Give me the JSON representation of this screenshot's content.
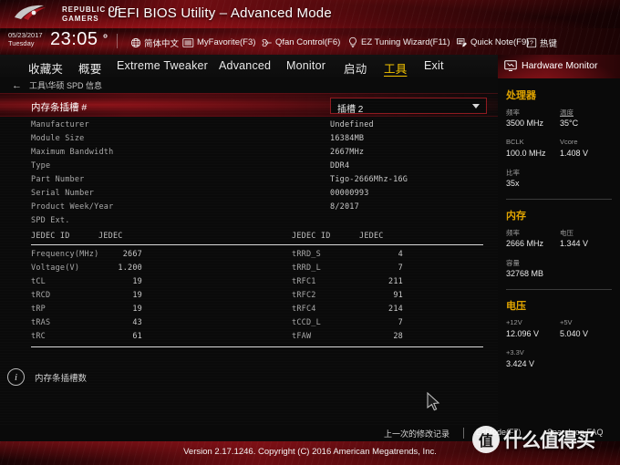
{
  "banner": {
    "brand_line1": "REPUBLIC OF",
    "brand_line2": "GAMERS",
    "title": "UEFI BIOS Utility – Advanced Mode",
    "logo_icon": "rog-eye-logo"
  },
  "toolbar": {
    "date": "05/23/2017",
    "weekday": "Tuesday",
    "time": "23:05",
    "gear_icon": "gear-icon",
    "items": [
      {
        "label": "简体中文",
        "icon": "globe-icon"
      },
      {
        "label": "MyFavorite(F3)",
        "icon": "bookmark-icon"
      },
      {
        "label": "Qfan Control(F6)",
        "icon": "fan-icon"
      },
      {
        "label": "EZ Tuning Wizard(F11)",
        "icon": "lightbulb-icon"
      },
      {
        "label": "Quick Note(F9)",
        "icon": "note-icon"
      },
      {
        "label": "热键",
        "icon": "question-key-icon"
      }
    ]
  },
  "nav": {
    "tabs": [
      {
        "label": "收藏夹",
        "active": false
      },
      {
        "label": "概要",
        "active": false
      },
      {
        "label": "Extreme Tweaker",
        "active": false
      },
      {
        "label": "Advanced",
        "active": false
      },
      {
        "label": "Monitor",
        "active": false
      },
      {
        "label": "启动",
        "active": false
      },
      {
        "label": "工具",
        "active": true
      },
      {
        "label": "Exit",
        "active": false
      }
    ]
  },
  "breadcrumb": {
    "back_arrow": "←",
    "path": "工具\\华硕 SPD 信息"
  },
  "main": {
    "selected_row_label": "内存条插槽 #",
    "dropdown": {
      "value": "插槽 2",
      "chevron_icon": "chevron-down-icon"
    },
    "specs": [
      {
        "key": "Manufacturer",
        "value": "Undefined"
      },
      {
        "key": "Module Size",
        "value": "16384MB"
      },
      {
        "key": "Maximum Bandwidth",
        "value": "2667MHz"
      },
      {
        "key": "Type",
        "value": "DDR4"
      },
      {
        "key": "Part Number",
        "value": "Tigo-2666Mhz-16G"
      },
      {
        "key": "Serial Number",
        "value": "00000993"
      },
      {
        "key": "Product Week/Year",
        "value": " 8/2017"
      },
      {
        "key": "SPD Ext.",
        "value": ""
      }
    ],
    "jedec_headers": {
      "id": "JEDEC ID",
      "profile": "JEDEC"
    },
    "jedec_left": [
      {
        "key": "Frequency(MHz)",
        "value": "2667"
      },
      {
        "key": "Voltage(V)",
        "value": "1.200"
      },
      {
        "key": "tCL",
        "value": "19"
      },
      {
        "key": "tRCD",
        "value": "19"
      },
      {
        "key": "tRP",
        "value": "19"
      },
      {
        "key": "tRAS",
        "value": "43"
      },
      {
        "key": "tRC",
        "value": "61"
      }
    ],
    "jedec_right": [
      {
        "key": "tRRD_S",
        "value": "4"
      },
      {
        "key": "tRRD_L",
        "value": "7"
      },
      {
        "key": "tRFC1",
        "value": "211"
      },
      {
        "key": "tRFC2",
        "value": "91"
      },
      {
        "key": "tRFC4",
        "value": "214"
      },
      {
        "key": "tCCD_L",
        "value": "7"
      },
      {
        "key": "tFAW",
        "value": "28"
      }
    ],
    "info": {
      "icon": "info-icon",
      "text": "内存条插槽数"
    }
  },
  "hardware_monitor": {
    "title": "Hardware Monitor",
    "title_icon": "monitor-icon",
    "sections": [
      {
        "name": "处理器",
        "rows": [
          {
            "label_left": "频率",
            "value_left": "3500 MHz",
            "label_right": "温度",
            "value_right": "35°C",
            "underline_right": true
          },
          {
            "label_left": "BCLK",
            "value_left": "100.0 MHz",
            "label_right": "Vcore",
            "value_right": "1.408 V",
            "underline_right": false
          },
          {
            "label_left": "比率",
            "value_left": "35x",
            "label_right": "",
            "value_right": "",
            "underline_right": false
          }
        ]
      },
      {
        "name": "内存",
        "rows": [
          {
            "label_left": "频率",
            "value_left": "2666 MHz",
            "label_right": "电压",
            "value_right": "1.344 V",
            "underline_right": false
          },
          {
            "label_left": "容量",
            "value_left": "32768 MB",
            "label_right": "",
            "value_right": "",
            "underline_right": false
          }
        ]
      },
      {
        "name": "电压",
        "rows": [
          {
            "label_left": "+12V",
            "value_left": "12.096 V",
            "label_right": "+5V",
            "value_right": "5.040 V",
            "underline_right": false
          },
          {
            "label_left": "+3.3V",
            "value_left": "3.424 V",
            "label_right": "",
            "value_right": "",
            "underline_right": false
          }
        ]
      }
    ]
  },
  "footer_bar": {
    "items": [
      {
        "label": "上一次的修改记录"
      },
      {
        "label": "EzMode(F7)"
      },
      {
        "label": "Search on FAQ"
      }
    ]
  },
  "footer": {
    "version": "Version 2.17.1246. Copyright (C) 2016 American Megatrends, Inc."
  },
  "watermark": {
    "mark": "值",
    "text": "什么值得买"
  },
  "cursor": {
    "icon": "mouse-pointer-icon"
  },
  "colors": {
    "rog_red": "#8e1a20",
    "accent_gold": "#e0a400",
    "panel_bg": "#0a0a0a",
    "text_primary": "#d8d8d8"
  }
}
